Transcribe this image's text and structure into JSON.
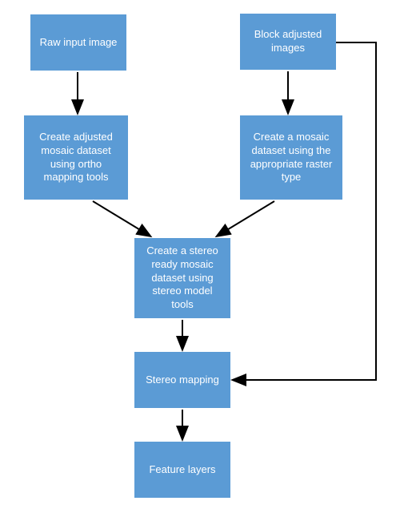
{
  "diagram": {
    "type": "flowchart",
    "title": "",
    "nodes": {
      "raw_input": {
        "label": "Raw input image"
      },
      "block_adjusted": {
        "label": "Block adjusted images"
      },
      "ortho_tools": {
        "label": "Create adjusted mosaic dataset using ortho mapping tools"
      },
      "mosaic_raster": {
        "label": "Create a mosaic dataset using the appropriate raster type"
      },
      "stereo_ready": {
        "label": "Create a stereo ready mosaic dataset using stereo model tools"
      },
      "stereo_mapping": {
        "label": "Stereo mapping"
      },
      "feature_layers": {
        "label": "Feature layers"
      }
    },
    "edges": [
      {
        "from": "raw_input",
        "to": "ortho_tools"
      },
      {
        "from": "block_adjusted",
        "to": "mosaic_raster"
      },
      {
        "from": "ortho_tools",
        "to": "stereo_ready"
      },
      {
        "from": "mosaic_raster",
        "to": "stereo_ready"
      },
      {
        "from": "stereo_ready",
        "to": "stereo_mapping"
      },
      {
        "from": "block_adjusted",
        "to": "stereo_mapping"
      },
      {
        "from": "stereo_mapping",
        "to": "feature_layers"
      }
    ],
    "colors": {
      "node_fill": "#5b9bd5",
      "node_text": "#ffffff",
      "arrow": "#000000"
    }
  }
}
